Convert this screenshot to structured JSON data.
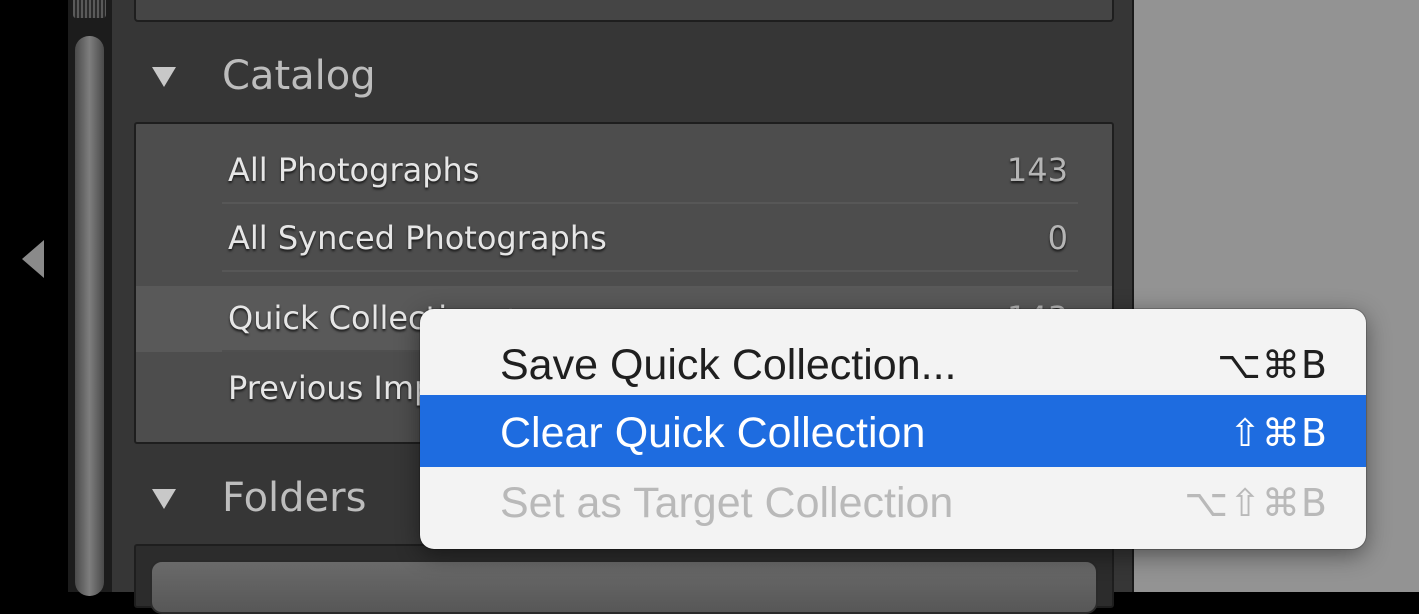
{
  "panel": {
    "catalog_section": {
      "title": "Catalog",
      "items": [
        {
          "label": "All Photographs",
          "count": "143"
        },
        {
          "label": "All Synced Photographs",
          "count": "0"
        },
        {
          "label": "Quick Collection +",
          "count": "143"
        },
        {
          "label": "Previous Import",
          "count": ""
        }
      ]
    },
    "folders_section": {
      "title": "Folders"
    }
  },
  "context_menu": {
    "items": [
      {
        "label": "Save Quick Collection...",
        "shortcut": "⌥⌘B",
        "state": "enabled"
      },
      {
        "label": "Clear Quick Collection",
        "shortcut": "⇧⌘B",
        "state": "selected"
      },
      {
        "label": "Set as Target Collection",
        "shortcut": "⌥⇧⌘B",
        "state": "disabled"
      }
    ]
  },
  "colors": {
    "menu_highlight": "#1e6ce0",
    "panel_background": "#363636",
    "list_background": "#4d4d4d"
  }
}
